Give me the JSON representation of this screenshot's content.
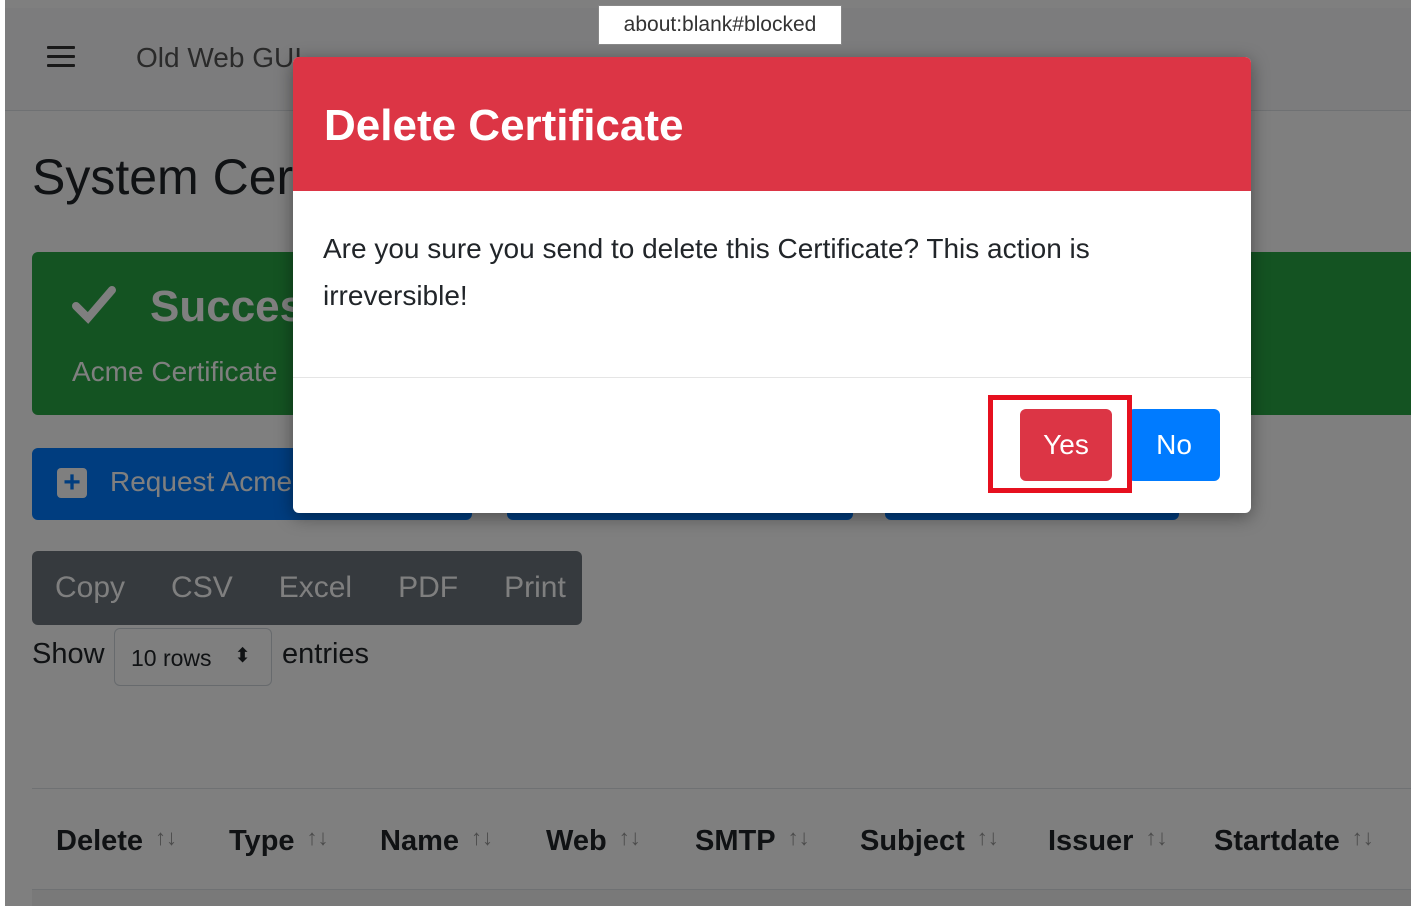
{
  "navbar": {
    "brand": "Old Web GUI"
  },
  "page": {
    "title": "System Certificates"
  },
  "alert": {
    "title": "Success",
    "text": "Acme Certificate",
    "color": "#28a745"
  },
  "actions": {
    "request_label": "Request Acme"
  },
  "export_buttons": [
    "Copy",
    "CSV",
    "Excel",
    "PDF",
    "Print"
  ],
  "length_menu": {
    "show_label": "Show",
    "selected": "10 rows",
    "entries_label": "entries"
  },
  "table": {
    "columns": [
      "Delete",
      "Type",
      "Name",
      "Web",
      "SMTP",
      "Subject",
      "Issuer",
      "Startdate"
    ],
    "sort_glyph": "↑↓"
  },
  "modal": {
    "title": "Delete Certificate",
    "body": "Are you sure you send to delete this Certificate? This action is irreversible!",
    "yes_label": "Yes",
    "no_label": "No",
    "header_color": "#dc3545"
  },
  "tooltip": {
    "text": "about:blank#blocked"
  }
}
